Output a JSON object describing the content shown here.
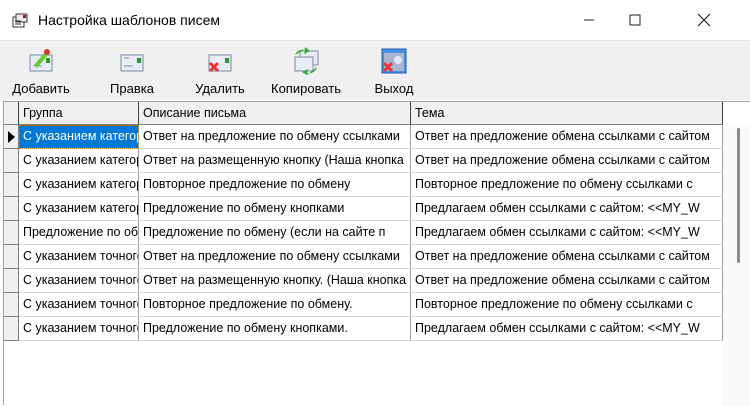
{
  "window": {
    "title": "Настройка шаблонов писем"
  },
  "toolbar": [
    {
      "label": "Добавить",
      "icon": "add-letter-icon"
    },
    {
      "label": "Правка",
      "icon": "edit-letter-icon"
    },
    {
      "label": "Удалить",
      "icon": "delete-letter-icon"
    },
    {
      "label": "Копировать",
      "icon": "copy-letter-icon"
    },
    {
      "label": "Выход",
      "icon": "exit-icon"
    }
  ],
  "grid": {
    "columns": [
      "Группа",
      "Описание письма",
      "Тема"
    ],
    "rows": [
      [
        "С указанием категории",
        "Ответ на предложение по обмену ссылками",
        "Ответ на предложение обмена ссылками с сайтом"
      ],
      [
        "С указанием категории",
        "Ответ на размещенную кнопку (Наша кнопка",
        "Ответ на предложение обмена ссылками с сайтом"
      ],
      [
        "С указанием категории",
        "Повторное предложение по обмену",
        "Повторное предложение по обмену ссылками с"
      ],
      [
        "С указанием категории",
        "Предложение по обмену кнопками",
        "Предлагаем обмен ссылками с сайтом: <<MY_W"
      ],
      [
        "Предложение по обмену",
        "Предложение по обмену (если на сайте п",
        "Предлагаем обмен ссылками с сайтом: <<MY_W"
      ],
      [
        "С указанием точного",
        "Ответ на предложение по обмену ссылками",
        "Ответ на предложение обмена ссылками с сайтом"
      ],
      [
        "С указанием точного",
        "Ответ на размещенную кнопку. (Наша кнопка",
        "Ответ на предложение обмена ссылками с сайтом"
      ],
      [
        "С указанием точного",
        "Повторное предложение по обмену.",
        "Повторное предложение по обмену ссылками с"
      ],
      [
        "С указанием точного",
        "Предложение по обмену кнопками.",
        "Предлагаем обмен ссылками с сайтом: <<MY_W"
      ]
    ],
    "selected_row": 0
  }
}
